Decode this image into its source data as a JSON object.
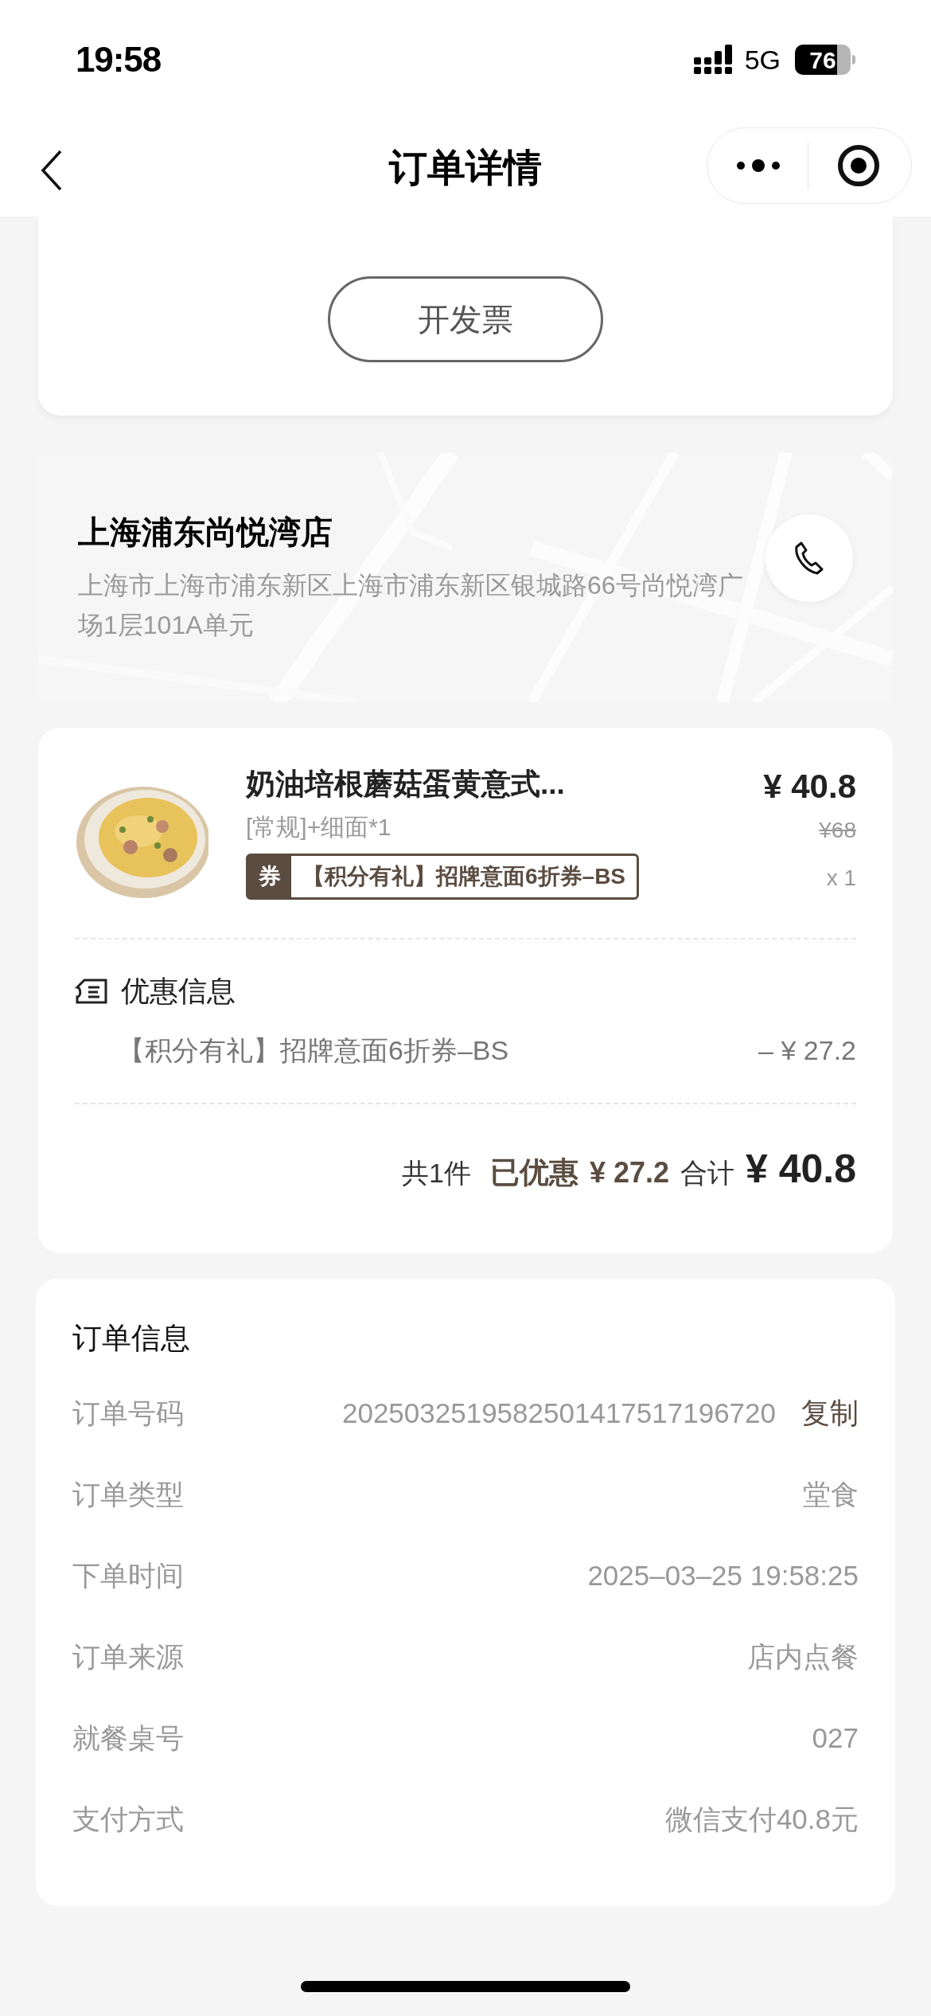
{
  "status_bar": {
    "time": "19:58",
    "network": "5G",
    "battery": "76"
  },
  "nav": {
    "title": "订单详情"
  },
  "invoice_button": "开发票",
  "store": {
    "name": "上海浦东尚悦湾店",
    "address": "上海市上海市浦东新区上海市浦东新区银城路66号尚悦湾广场1层101A单元"
  },
  "item": {
    "name": "奶油培根蘑菇蛋黄意式...",
    "spec": "[常规]+细面*1",
    "coupon_tag": "券",
    "coupon": "【积分有礼】招牌意面6折券–BS",
    "price": "¥ 40.8",
    "original_price": "¥68",
    "quantity": "x 1"
  },
  "discounts": {
    "title": "优惠信息",
    "rows": [
      {
        "label": "【积分有礼】招牌意面6折券–BS",
        "amount": "– ¥ 27.2"
      }
    ]
  },
  "summary": {
    "count": "共1件",
    "saved_label": "已优惠",
    "saved": "¥ 27.2",
    "total_label": "合计",
    "total": "¥ 40.8"
  },
  "order_info": {
    "title": "订单信息",
    "rows": [
      {
        "label": "订单号码",
        "value": "2025032519582501417517196720",
        "action": "复制"
      },
      {
        "label": "订单类型",
        "value": "堂食"
      },
      {
        "label": "下单时间",
        "value": "2025–03–25 19:58:25"
      },
      {
        "label": "订单来源",
        "value": "店内点餐"
      },
      {
        "label": "就餐桌号",
        "value": "027"
      },
      {
        "label": "支付方式",
        "value": "微信支付40.8元"
      }
    ]
  }
}
